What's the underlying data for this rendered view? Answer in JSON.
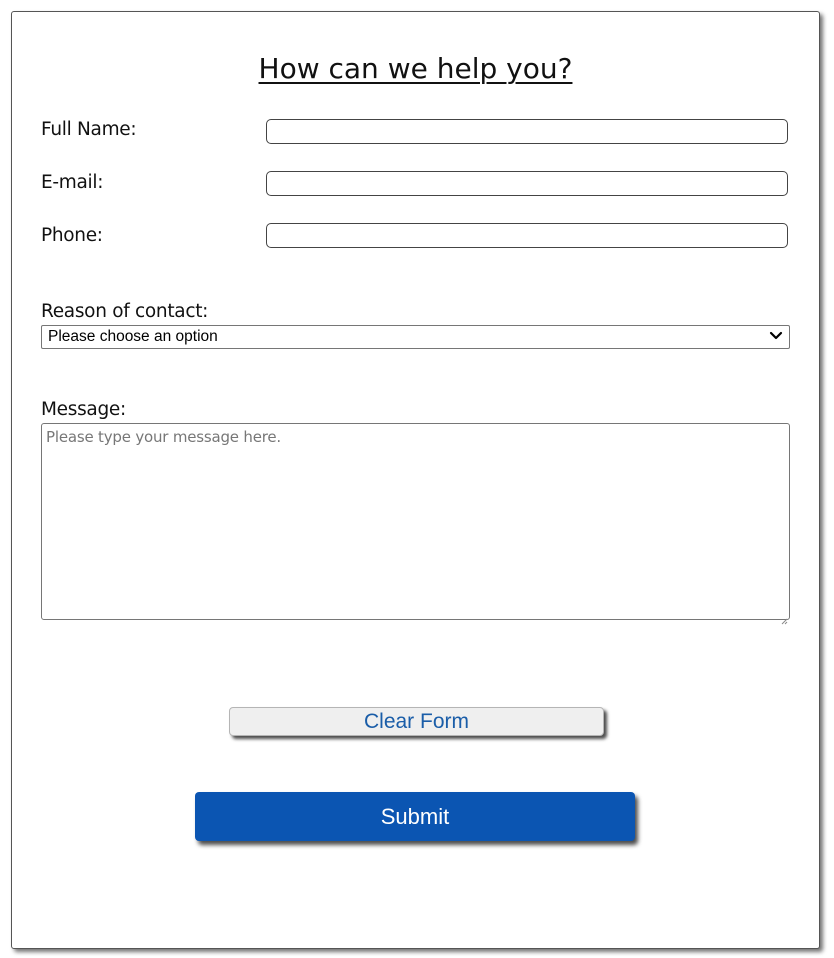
{
  "form": {
    "title": "How can we help you?",
    "fields": {
      "full_name": {
        "label": "Full Name:",
        "value": ""
      },
      "email": {
        "label": "E-mail:",
        "value": ""
      },
      "phone": {
        "label": "Phone:",
        "value": ""
      }
    },
    "reason": {
      "label": "Reason of contact:",
      "selected": "Please choose an option"
    },
    "message": {
      "label": "Message:",
      "placeholder": "Please type your message here.",
      "value": ""
    },
    "buttons": {
      "clear_label": "Clear Form",
      "submit_label": "Submit"
    }
  },
  "colors": {
    "submit_background": "#0b55b2",
    "submit_text": "#ffffff",
    "clear_background": "#efefef",
    "clear_text": "#1a5da8",
    "border": "#444444",
    "placeholder_text": "#777777"
  },
  "icons": {
    "select_arrow": "chevron-down-icon",
    "textarea_grip": "resize-handle-icon"
  }
}
